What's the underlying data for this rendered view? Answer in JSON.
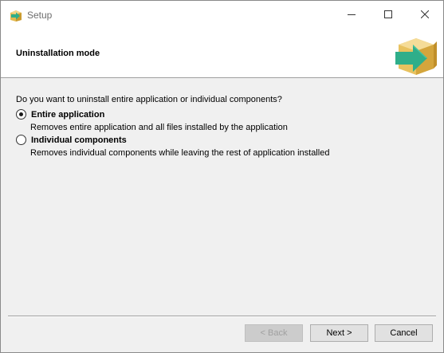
{
  "window": {
    "title": "Setup",
    "app_icon": "setup-package-icon",
    "controls": {
      "minimize": "minimize-icon",
      "maximize": "maximize-icon",
      "close": "close-icon"
    }
  },
  "header": {
    "title": "Uninstallation mode",
    "image": "package-arrow-icon"
  },
  "content": {
    "question": "Do you want to uninstall entire application or individual components?",
    "options": [
      {
        "label": "Entire application",
        "description": "Removes entire application and all files installed by the application",
        "selected": true
      },
      {
        "label": "Individual components",
        "description": "Removes individual components while leaving the rest of application installed",
        "selected": false
      }
    ]
  },
  "buttons": {
    "back": "< Back",
    "next": "Next >",
    "cancel": "Cancel",
    "back_enabled": false
  },
  "colors": {
    "dialog_background": "#f0f0f0",
    "header_background": "#ffffff",
    "icon_box": "#e8c25f",
    "icon_arrow": "#2fae8a"
  }
}
